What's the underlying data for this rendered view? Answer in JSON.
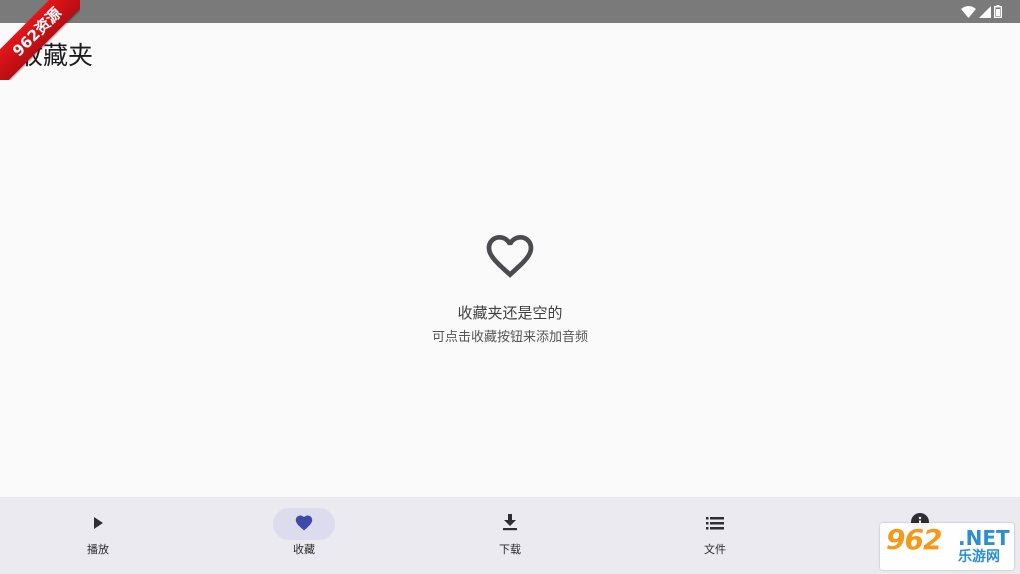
{
  "statusbar": {
    "icons": [
      "wifi-icon",
      "cell-signal-icon",
      "battery-icon"
    ]
  },
  "watermark": {
    "ribbon_text": "962资源",
    "logo_number": "962",
    "logo_suffix": ".NET",
    "logo_subtitle": "乐游网"
  },
  "header": {
    "title": "收藏夹"
  },
  "empty_state": {
    "icon": "heart-outline-icon",
    "title": "收藏夹还是空的",
    "subtitle": "可点击收藏按钮来添加音频"
  },
  "bottom_nav": {
    "items": [
      {
        "label": "播放",
        "icon": "play-icon",
        "active": false
      },
      {
        "label": "收藏",
        "icon": "heart-icon",
        "active": true
      },
      {
        "label": "下载",
        "icon": "download-icon",
        "active": false
      },
      {
        "label": "文件",
        "icon": "list-icon",
        "active": false
      },
      {
        "label": "",
        "icon": "info-icon",
        "active": false
      }
    ]
  },
  "colors": {
    "accent": "#3f51b5",
    "nav_background": "#ebeaf1",
    "status_bar": "#7a7a7a",
    "background": "#fafafa"
  }
}
